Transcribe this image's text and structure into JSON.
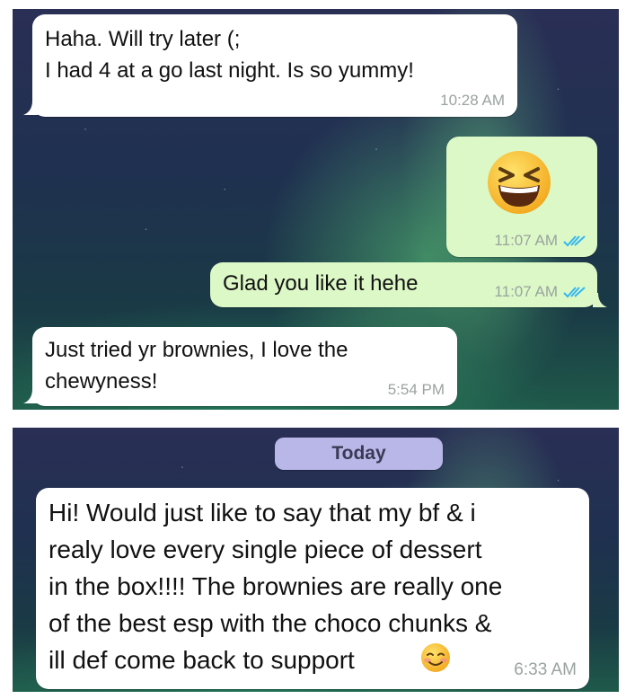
{
  "colors": {
    "incoming_bubble": "#ffffff",
    "outgoing_bubble": "#dcf8c6",
    "read_ticks": "#34b7f1",
    "date_chip": "#b9b7e8"
  },
  "screenshot1": {
    "messages": [
      {
        "direction": "incoming",
        "text": "Haha.  Will try later (;\nI had 4 at a go last night.  Is so yummy!",
        "time": "10:28 AM"
      },
      {
        "direction": "outgoing",
        "emoji_icon": "grinning-squinting-face-icon",
        "time": "11:07 AM",
        "status": "read"
      },
      {
        "direction": "outgoing",
        "text": "Glad you like it hehe",
        "time": "11:07 AM",
        "status": "read"
      },
      {
        "direction": "incoming",
        "text": "Just tried yr brownies,  I love  the\nchewyness!",
        "time": "5:54 PM"
      }
    ]
  },
  "screenshot2": {
    "date_label": "Today",
    "messages": [
      {
        "direction": "incoming",
        "text": "Hi! Would just like to say that my bf & i\nrealy love every single piece of dessert\nin the box!!!! The brownies are really one\nof the best esp with the choco chunks &\nill def come back to support",
        "emoji_icon": "smiling-face-icon",
        "time": "6:33 AM"
      }
    ]
  }
}
